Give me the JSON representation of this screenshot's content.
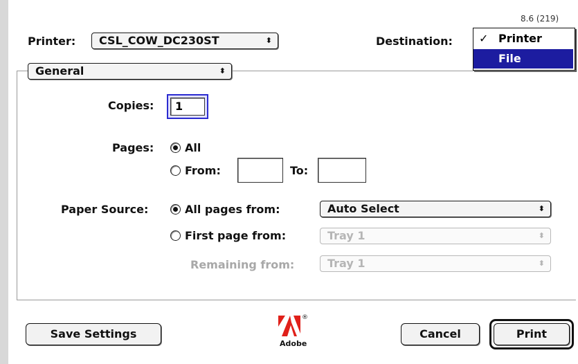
{
  "version": "8.6 (219)",
  "printer": {
    "label": "Printer:",
    "value": "CSL_COW_DC230ST"
  },
  "destination": {
    "label": "Destination:",
    "options": [
      "Printer",
      "File"
    ],
    "selected": "Printer",
    "highlighted": "File"
  },
  "panel_popup": {
    "value": "General"
  },
  "copies": {
    "label": "Copies:",
    "value": "1"
  },
  "pages": {
    "label": "Pages:",
    "all_label": "All",
    "from_label": "From:",
    "to_label": "To:",
    "from_value": "",
    "to_value": ""
  },
  "paper_source": {
    "label": "Paper Source:",
    "all_pages_label": "All pages from:",
    "all_pages_value": "Auto Select",
    "first_page_label": "First page from:",
    "first_page_value": "Tray 1",
    "remaining_label": "Remaining from:",
    "remaining_value": "Tray 1"
  },
  "buttons": {
    "save_settings": "Save Settings",
    "cancel": "Cancel",
    "print": "Print"
  },
  "logo": {
    "text": "Adobe",
    "mark": "®"
  },
  "colors": {
    "menu_highlight": "#1c1ca0",
    "selected_field": "#2b2bd0",
    "field_tint": "#e0e0ff"
  }
}
